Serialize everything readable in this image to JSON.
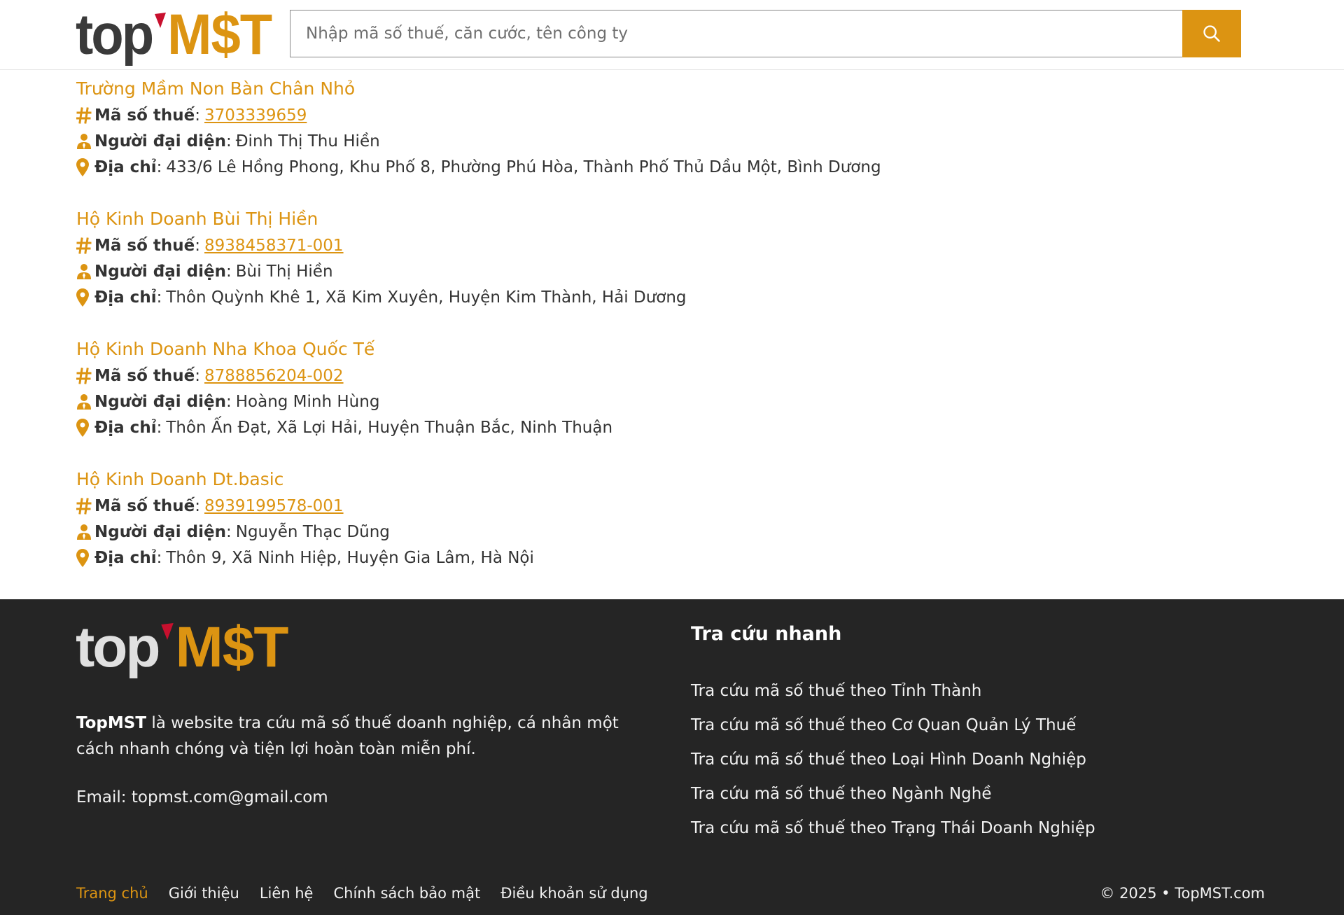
{
  "brand": {
    "logo_top": "top",
    "logo_mst": "M$T",
    "accent_color": "#dc9412",
    "dark_color": "#252525"
  },
  "search": {
    "placeholder": "Nhập mã số thuế, căn cước, tên công ty",
    "value": "",
    "button_icon": "search-icon"
  },
  "labels": {
    "tax_code": "Mã số thuế",
    "representative": "Người đại diện",
    "address": "Địa chỉ",
    "separator": ":"
  },
  "companies": [
    {
      "name": "Trường Mầm Non Bàn Chân Nhỏ",
      "tax_code": "3703339659",
      "representative": "Đinh Thị Thu Hiền",
      "address": "433/6 Lê Hồng Phong, Khu Phố 8, Phường Phú Hòa, Thành Phố Thủ Dầu Một, Bình Dương"
    },
    {
      "name": "Hộ Kinh Doanh Bùi Thị Hiền",
      "tax_code": "8938458371-001",
      "representative": "Bùi Thị Hiền",
      "address": "Thôn Quỳnh Khê 1, Xã Kim Xuyên, Huyện Kim Thành, Hải Dương"
    },
    {
      "name": "Hộ Kinh Doanh Nha Khoa Quốc Tế",
      "tax_code": "8788856204-002",
      "representative": "Hoàng Minh Hùng",
      "address": "Thôn Ấn Đạt, Xã Lợi Hải, Huyện Thuận Bắc, Ninh Thuận"
    },
    {
      "name": "Hộ Kinh Doanh Dt.basic",
      "tax_code": "8939199578-001",
      "representative": "Nguyễn Thạc Dũng",
      "address": "Thôn 9, Xã Ninh Hiệp, Huyện Gia Lâm, Hà Nội"
    }
  ],
  "footer": {
    "desc_brand": "TopMST",
    "desc_text": " là website tra cứu mã số thuế doanh nghiệp, cá nhân một cách nhanh chóng và tiện lợi hoàn toàn miễn phí.",
    "email": "Email: topmst.com@gmail.com",
    "quick_title": "Tra cứu nhanh",
    "quick_links": [
      "Tra cứu mã số thuế theo Tỉnh Thành",
      "Tra cứu mã số thuế theo Cơ Quan Quản Lý Thuế",
      "Tra cứu mã số thuế theo Loại Hình Doanh Nghiệp",
      "Tra cứu mã số thuế theo Ngành Nghề",
      "Tra cứu mã số thuế theo Trạng Thái Doanh Nghiệp"
    ],
    "nav": [
      "Trang chủ",
      "Giới thiệu",
      "Liên hệ",
      "Chính sách bảo mật",
      "Điều khoản sử dụng"
    ],
    "copyright": "© 2025 • TopMST.com"
  }
}
